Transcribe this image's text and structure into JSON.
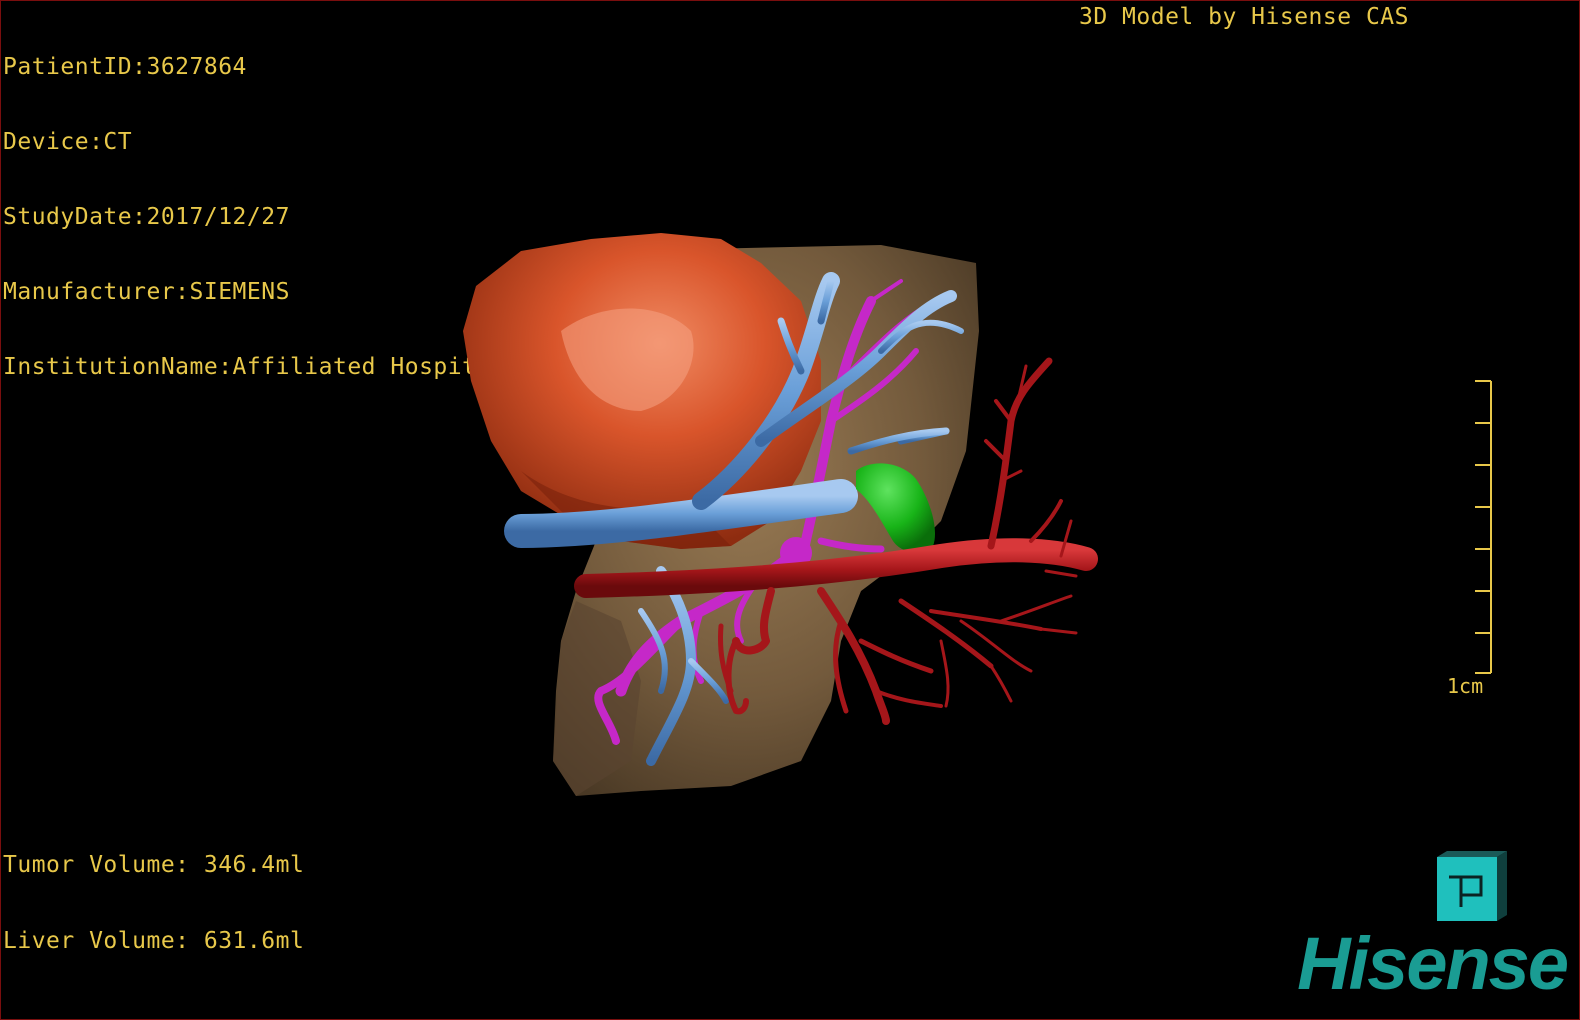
{
  "header": {
    "patient_id": "PatientID:3627864",
    "device": "Device:CT",
    "study_date": "StudyDate:2017/12/27",
    "manufacturer": "Manufacturer:SIEMENS",
    "institution": "InstitutionName:Affiliated Hospital Qingdao University-C",
    "credit": "3D Model by Hisense CAS"
  },
  "volumes": {
    "tumor": "Tumor Volume: 346.4ml",
    "liver": "Liver Volume: 631.6ml"
  },
  "scale": {
    "label": "1cm"
  },
  "brand": {
    "name": "Hisense"
  },
  "colors": {
    "text_overlay": "#e8c84a",
    "liver": "#7a6142",
    "tumor": "#d2522a",
    "portal_vein": "#6fa2dc",
    "hepatic_artery": "#c528c8",
    "inferior_vena_cava": "#a5161a",
    "gallbladder": "#18b418",
    "brand": "#1a9c93"
  },
  "icons": {
    "orientation_cube": "orientation-cube-icon"
  }
}
